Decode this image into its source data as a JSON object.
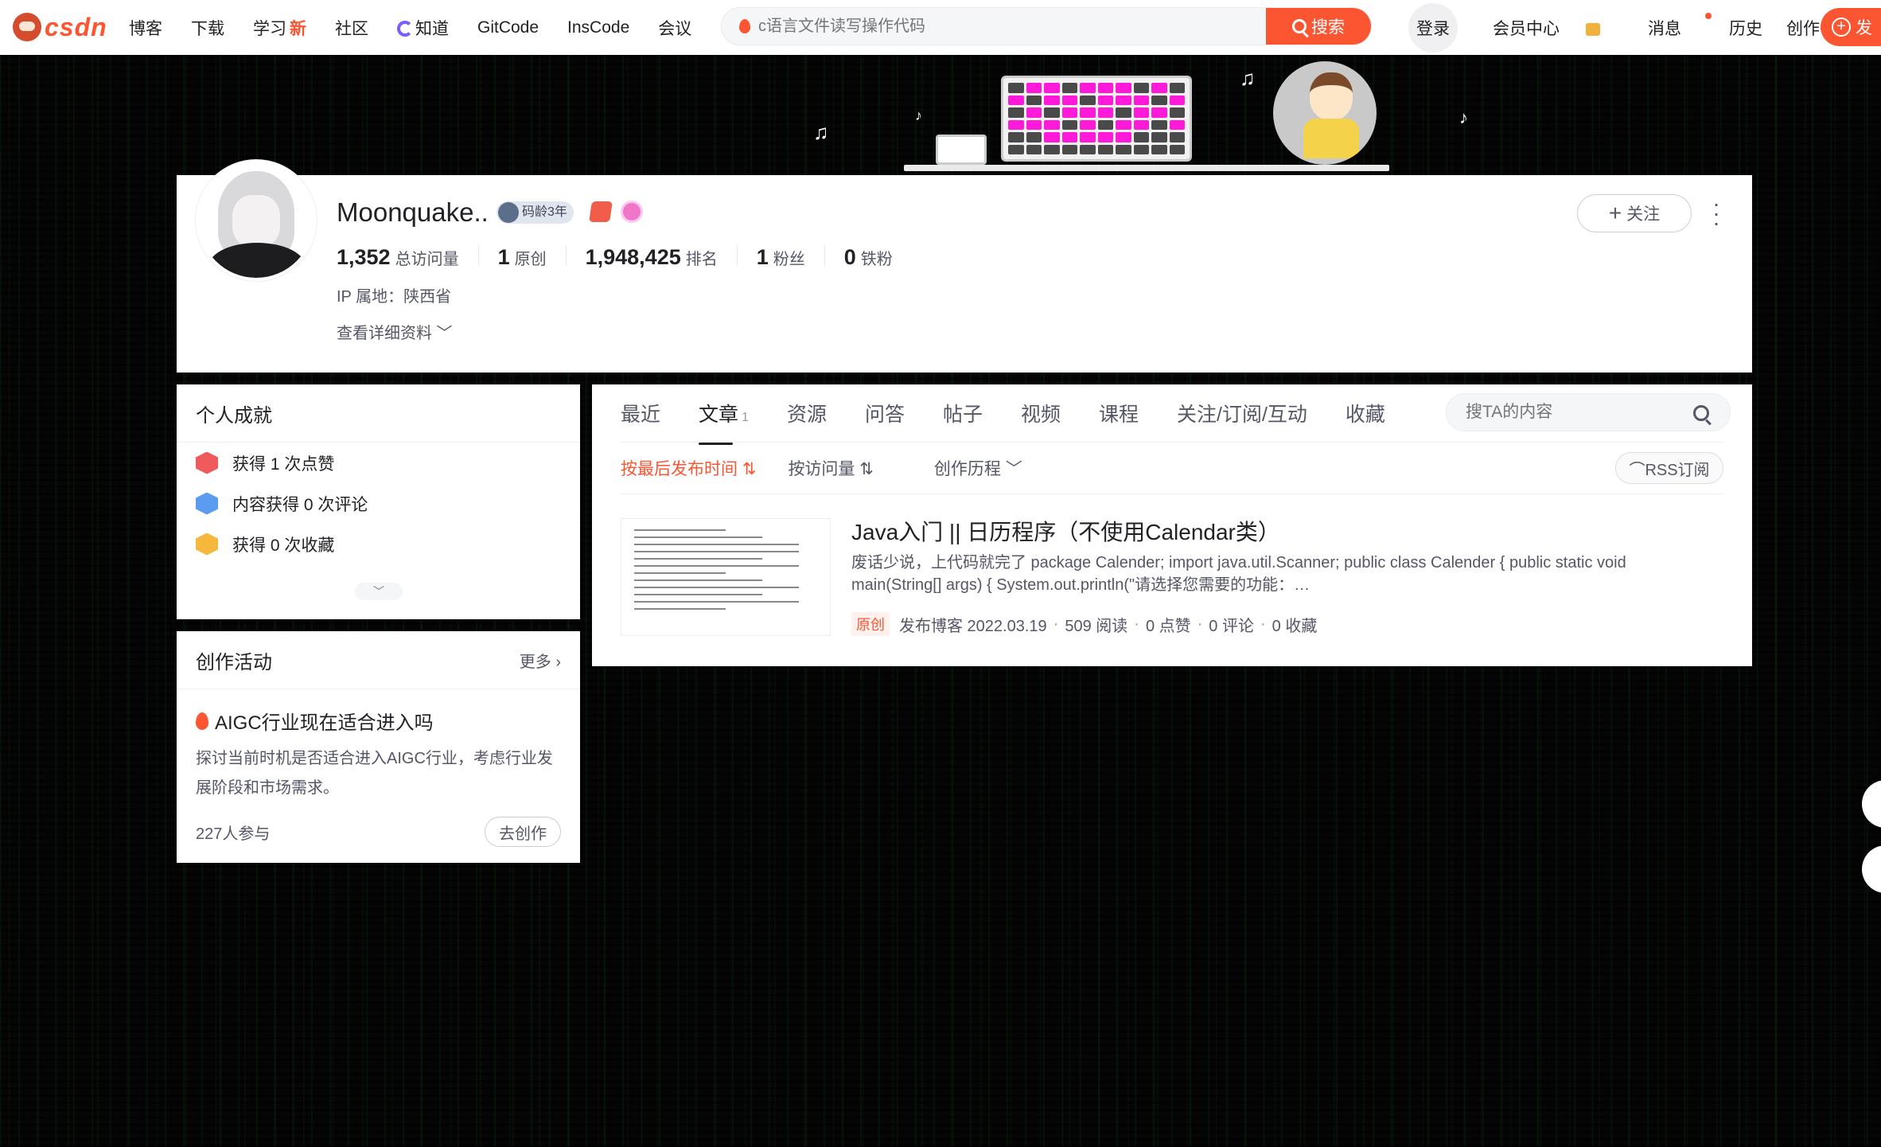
{
  "nav": {
    "logo": "csdn",
    "items": [
      {
        "label": "博客"
      },
      {
        "label": "下载"
      },
      {
        "label": "学习",
        "badge": "新"
      },
      {
        "label": "社区"
      },
      {
        "label": "知道"
      },
      {
        "label": "GitCode"
      },
      {
        "label": "InsCode"
      },
      {
        "label": "会议"
      }
    ],
    "search_placeholder": "c语言文件读写操作代码",
    "search_button": "搜索",
    "login": "登录",
    "vip": "会员中心",
    "messages": "消息",
    "history": "历史",
    "creator_center": "创作中心",
    "publish": "发"
  },
  "profile": {
    "name": "Moonquake..",
    "badge": "码龄3年",
    "stats": [
      {
        "value": "1,352",
        "label": "总访问量"
      },
      {
        "value": "1",
        "label": "原创"
      },
      {
        "value": "1,948,425",
        "label": "排名"
      },
      {
        "value": "1",
        "label": "粉丝"
      },
      {
        "value": "0",
        "label": "铁粉"
      }
    ],
    "ip": "IP 属地：陕西省",
    "detail_link": "查看详细资料",
    "follow": "关注"
  },
  "achievements": {
    "title": "个人成就",
    "items": [
      "获得 1 次点赞",
      "内容获得 0 次评论",
      "获得 0 次收藏"
    ]
  },
  "activity": {
    "title": "创作活动",
    "more": "更多",
    "topic": "AIGC行业现在适合进入吗",
    "desc": "探讨当前时机是否适合进入AIGC行业，考虑行业发展阶段和市场需求。",
    "participants": "227人参与",
    "go": "去创作"
  },
  "tabs": {
    "items": [
      "最近",
      "文章",
      "资源",
      "问答",
      "帖子",
      "视频",
      "课程",
      "关注/订阅/互动",
      "收藏"
    ],
    "article_count": "1",
    "search_placeholder": "搜TA的内容"
  },
  "subtabs": {
    "sort_latest": "按最后发布时间",
    "sort_views": "按访问量",
    "history": "创作历程",
    "rss": "RSS订阅"
  },
  "article": {
    "title": "Java入门 || 日历程序（不使用Calendar类）",
    "desc": "废话少说，上代码就完了 package Calender; import java.util.Scanner; public class Calender { public static void main(String[] args) { System.out.println(\"请选择您需要的功能：…",
    "tag": "原创",
    "date": "发布博客 2022.03.19",
    "reads": "509 阅读",
    "likes": "0 点赞",
    "comments": "0 评论",
    "favorites": "0 收藏"
  }
}
